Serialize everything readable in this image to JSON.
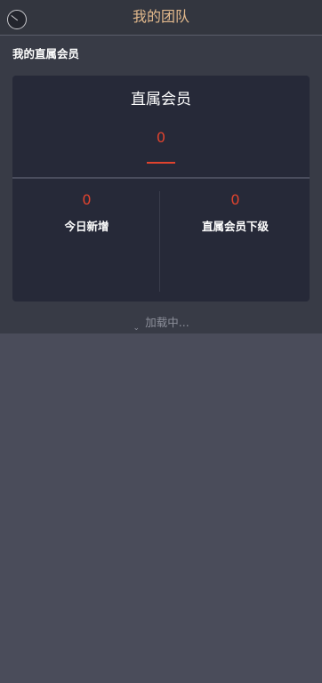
{
  "header": {
    "title": "我的团队",
    "back_icon": "back-circle-icon"
  },
  "section": {
    "title": "我的直属会员"
  },
  "card": {
    "title": "直属会员",
    "value": "0",
    "stats": [
      {
        "value": "0",
        "label": "今日新增"
      },
      {
        "value": "0",
        "label": "直属会员下级"
      }
    ]
  },
  "loading": {
    "icon": "spinner-icon",
    "text": "加载中..."
  },
  "colors": {
    "title": "#e2b98c",
    "accent": "#e0432e",
    "card_bg": "#262938",
    "page_bg": "#4a4c5a"
  }
}
